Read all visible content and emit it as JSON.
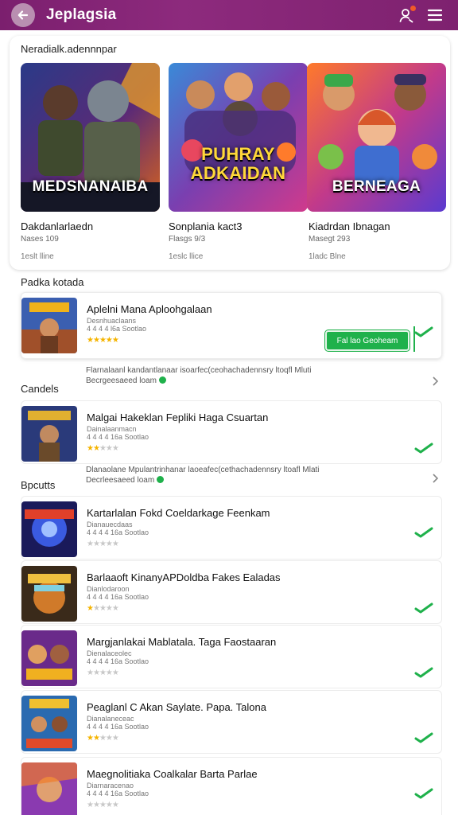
{
  "header": {
    "title": "Jeplagsia",
    "back_icon": "arrow-left-icon",
    "search_user_icon": "user-search-icon",
    "menu_icon": "hamburger-menu-icon",
    "colors": {
      "bar": "#7b1f6e",
      "accent": "#1fb14b"
    }
  },
  "featured": {
    "heading": "Neradialk.adennnpar",
    "tiles": [
      {
        "caption": "MEDSNANAIBA",
        "title": "Dakdanlarlaedn",
        "sub": "Nases 109",
        "meta": "1eslt lline"
      },
      {
        "caption": "PUHRAY ADKAIDAN",
        "title": "Sonplania kact3",
        "sub": "Flasgs 9/3",
        "meta": "1eslc llice"
      },
      {
        "caption": "BERNEAGA",
        "title": "Kiadrdan Ibnagan",
        "sub": "Masegt 293",
        "meta": "1ladc Blne"
      }
    ]
  },
  "sections": {
    "s1": "Padka kotada",
    "s2": "Candels",
    "s3": "Bpcutts"
  },
  "rows": [
    {
      "title": "Aplelni Mana Aploohgalaan",
      "sub": "Desnhuaclaans",
      "meta": "4 4 4 4 l6a  Sootlao",
      "rating": 5,
      "button": "Fal lao Geoheam"
    },
    {
      "title": "Malgai Hakeklan Fepliki Haga Csuartan",
      "sub": "Dainalaanmacn",
      "meta": "4 4 4 4  16a  Sootlao",
      "rating": 2
    },
    {
      "title": "Kartarlalan Fokd Coeldarkage Feenkam",
      "sub": "Dianauecdaas",
      "meta": "4 4 4 4  16a  Sootlao",
      "rating": 0
    },
    {
      "title": "Barlaaoft KinanyAPDoldba Fakes Ealadas",
      "sub": "Dianlodaroon",
      "meta": "4 4 4 4  16a  Sootlao",
      "rating": 1
    },
    {
      "title": "Margjanlakai Mablatala. Taga Faostaaran",
      "sub": "Dienalaceolec",
      "meta": "4 4 4 4  16a  Sootlao",
      "rating": 0
    },
    {
      "title": "Peaglanl C Akan Saylate. Papa. Talona",
      "sub": "Dianalaneceac",
      "meta": "4 4 4 4  16a  Sootlao",
      "rating": 2
    },
    {
      "title": "Maegnolitiaka Coalkalar Barta Parlae",
      "sub": "Diarnaracenao",
      "meta": "4 4 4 4  16a  Sootlao",
      "rating": 0
    }
  ],
  "info": [
    {
      "line1": "Flarnalaanl kandantlanaar isoarfec(ceohachadennsry ltoqfl Mluti",
      "line2": "Becrgeesaeed loam"
    },
    {
      "line1": "Dlanaolane Mpulantrinhanar laoeafec(cethachadennsry ltoafl Mlati",
      "line2": "Decrleesaeed loam"
    }
  ]
}
